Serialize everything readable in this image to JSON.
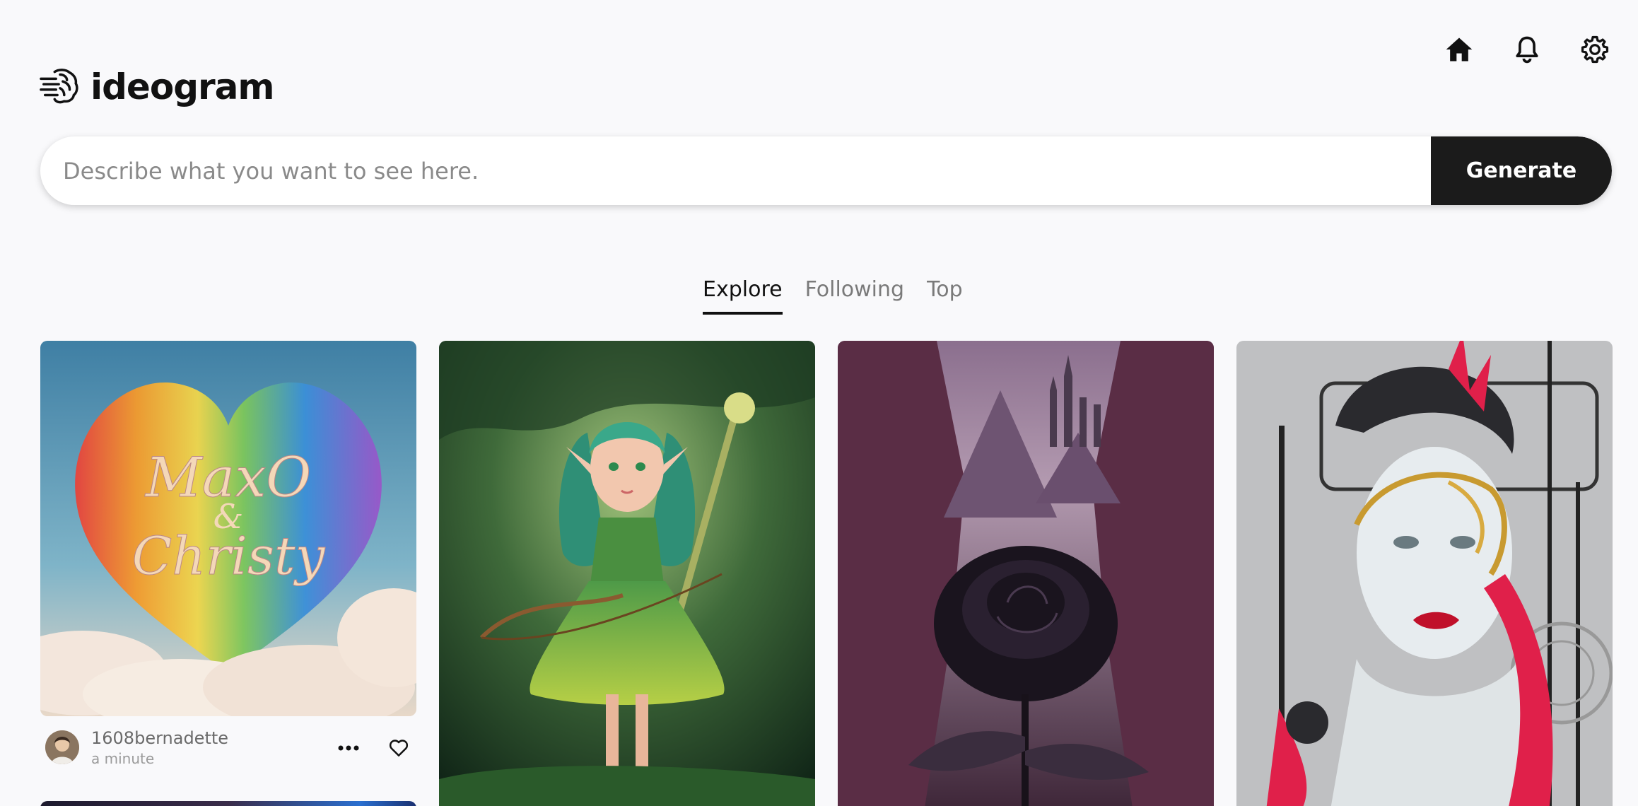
{
  "nav": {
    "icons": [
      "home-icon",
      "bell-icon",
      "settings-icon"
    ]
  },
  "brand": {
    "name": "ideogram",
    "logo_icon": "brain-logo-icon"
  },
  "search": {
    "placeholder": "Describe what you want to see here.",
    "value": "",
    "generate_label": "Generate"
  },
  "tabs": [
    {
      "label": "Explore",
      "active": true
    },
    {
      "label": "Following",
      "active": false
    },
    {
      "label": "Top",
      "active": false
    }
  ],
  "gallery": {
    "cards": [
      {
        "image_subject": "rainbow fluffy heart with script text",
        "author": "1608bernadette",
        "time": "a minute"
      },
      {
        "image_subject": "green forest elf archer"
      },
      {
        "image_subject": "black rose in purple mountain valley with castle"
      },
      {
        "image_subject": "woman face with golden mask and red accents"
      }
    ],
    "card_actions": [
      "more-options-icon",
      "heart-icon"
    ]
  },
  "colors": {
    "background": "#f9f9fb",
    "generate_button": "#1b1b1b",
    "text_primary": "#111111",
    "text_muted": "#7a7a7a"
  }
}
